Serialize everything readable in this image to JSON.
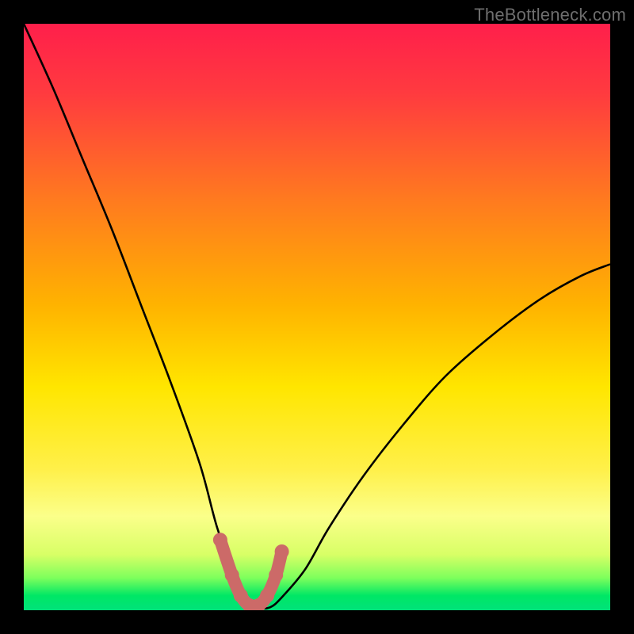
{
  "watermark": "TheBottleneck.com",
  "colors": {
    "background": "#000000",
    "gradient_stops": [
      {
        "offset": 0.0,
        "color": "#ff1f4b"
      },
      {
        "offset": 0.12,
        "color": "#ff3b3f"
      },
      {
        "offset": 0.3,
        "color": "#ff7a1f"
      },
      {
        "offset": 0.48,
        "color": "#ffb300"
      },
      {
        "offset": 0.62,
        "color": "#ffe600"
      },
      {
        "offset": 0.76,
        "color": "#fff04a"
      },
      {
        "offset": 0.84,
        "color": "#fbff8a"
      },
      {
        "offset": 0.905,
        "color": "#d8ff66"
      },
      {
        "offset": 0.945,
        "color": "#7dff5c"
      },
      {
        "offset": 0.975,
        "color": "#00e765"
      },
      {
        "offset": 1.0,
        "color": "#00e27a"
      }
    ],
    "curve": "#000000",
    "cap": "#cc6a68"
  },
  "chart_data": {
    "type": "line",
    "title": "",
    "xlabel": "",
    "ylabel": "",
    "xlim": [
      0,
      100
    ],
    "ylim": [
      0,
      100
    ],
    "series": [
      {
        "name": "bottleneck-curve",
        "x": [
          0,
          5,
          10,
          15,
          20,
          25,
          30,
          33,
          36,
          38,
          40,
          42,
          44,
          48,
          52,
          58,
          65,
          72,
          80,
          88,
          95,
          100
        ],
        "y": [
          100,
          89,
          77,
          65,
          52,
          39,
          25,
          14,
          6,
          2.2,
          0.5,
          0.5,
          2.2,
          7,
          14,
          23,
          32,
          40,
          47,
          53,
          57,
          59
        ]
      }
    ],
    "cap_segment": {
      "x": [
        33.5,
        35.5,
        37.0,
        38.5,
        40.0,
        41.5,
        43.0,
        44.0
      ],
      "y": [
        12.0,
        6.0,
        2.5,
        0.8,
        0.8,
        2.5,
        6.0,
        10.0
      ]
    }
  }
}
